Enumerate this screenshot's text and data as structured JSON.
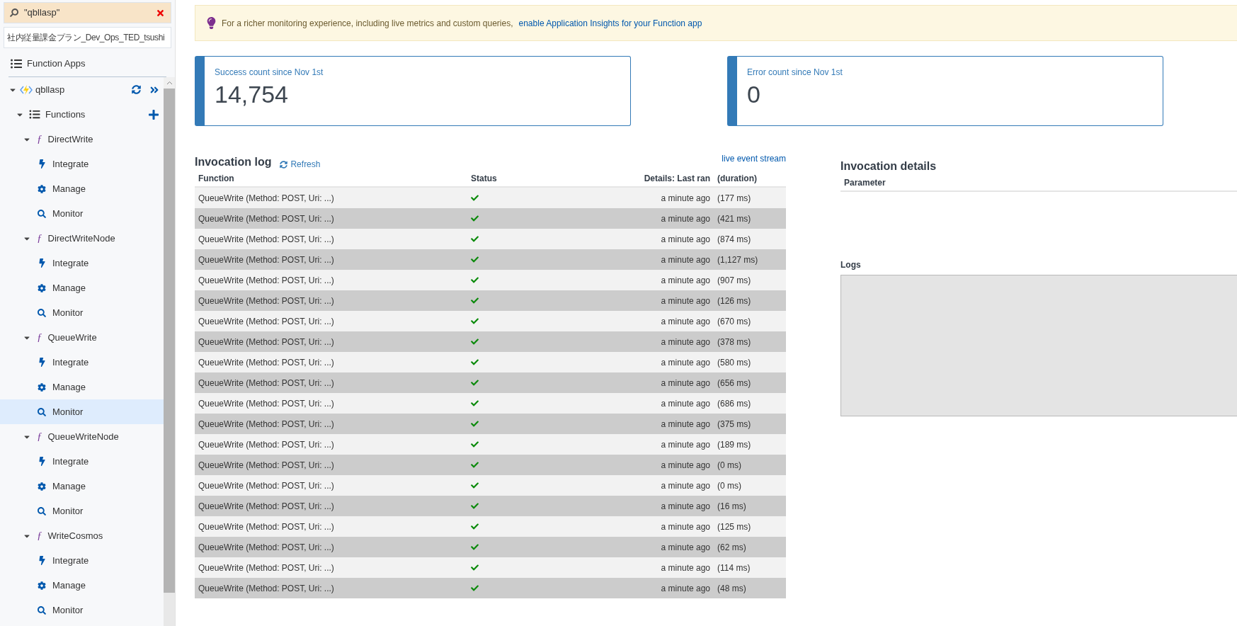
{
  "sidebar": {
    "search": {
      "value": "\"qbllasp\""
    },
    "subscription": {
      "value": "社内従量課金プラン_Dev_Ops_TED_tsushi"
    },
    "function_apps": {
      "label": "Function Apps"
    },
    "app": {
      "name": "qbllasp",
      "expanded": true,
      "functions": {
        "label": "Functions",
        "expanded": true,
        "children": [
          {
            "name": "DirectWrite",
            "glyph": "ƒ",
            "expanded": true,
            "children": [
              {
                "kind": "integrate",
                "label": "Integrate",
                "selected": false
              },
              {
                "kind": "manage",
                "label": "Manage",
                "selected": false
              },
              {
                "kind": "monitor",
                "label": "Monitor",
                "selected": false
              }
            ]
          },
          {
            "name": "DirectWriteNode",
            "glyph": "ƒ",
            "expanded": true,
            "children": [
              {
                "kind": "integrate",
                "label": "Integrate",
                "selected": false
              },
              {
                "kind": "manage",
                "label": "Manage",
                "selected": false
              },
              {
                "kind": "monitor",
                "label": "Monitor",
                "selected": false
              }
            ]
          },
          {
            "name": "QueueWrite",
            "glyph": "ƒ",
            "expanded": true,
            "children": [
              {
                "kind": "integrate",
                "label": "Integrate",
                "selected": false
              },
              {
                "kind": "manage",
                "label": "Manage",
                "selected": false
              },
              {
                "kind": "monitor",
                "label": "Monitor",
                "selected": true
              }
            ]
          },
          {
            "name": "QueueWriteNode",
            "glyph": "ƒ",
            "expanded": true,
            "children": [
              {
                "kind": "integrate",
                "label": "Integrate",
                "selected": false
              },
              {
                "kind": "manage",
                "label": "Manage",
                "selected": false
              },
              {
                "kind": "monitor",
                "label": "Monitor",
                "selected": false
              }
            ]
          },
          {
            "name": "WriteCosmos",
            "glyph": "ƒ",
            "expanded": true,
            "children": [
              {
                "kind": "integrate",
                "label": "Integrate",
                "selected": false
              },
              {
                "kind": "manage",
                "label": "Manage",
                "selected": false
              },
              {
                "kind": "monitor",
                "label": "Monitor",
                "selected": false
              }
            ]
          }
        ]
      }
    }
  },
  "banner": {
    "text": "For a richer monitoring experience, including live metrics and custom queries,",
    "link": "enable Application Insights for your Function app"
  },
  "cards": [
    {
      "label": "Success count since Nov 1st",
      "value": "14,754"
    },
    {
      "label": "Error count since Nov 1st",
      "value": "0"
    }
  ],
  "invocation_log": {
    "title": "Invocation log",
    "refresh": "Refresh",
    "live_stream": "live event stream",
    "columns": [
      "Function",
      "Status",
      "Details: Last ran",
      "(duration)"
    ],
    "rows": [
      {
        "function": "QueueWrite (Method: POST, Uri: ...)",
        "kind": "success",
        "last_ran": "a minute ago",
        "duration": "(177 ms)"
      },
      {
        "function": "QueueWrite (Method: POST, Uri: ...)",
        "kind": "success",
        "last_ran": "a minute ago",
        "duration": "(421 ms)"
      },
      {
        "function": "QueueWrite (Method: POST, Uri: ...)",
        "kind": "success",
        "last_ran": "a minute ago",
        "duration": "(874 ms)"
      },
      {
        "function": "QueueWrite (Method: POST, Uri: ...)",
        "kind": "success",
        "last_ran": "a minute ago",
        "duration": "(1,127 ms)"
      },
      {
        "function": "QueueWrite (Method: POST, Uri: ...)",
        "kind": "success",
        "last_ran": "a minute ago",
        "duration": "(907 ms)"
      },
      {
        "function": "QueueWrite (Method: POST, Uri: ...)",
        "kind": "success",
        "last_ran": "a minute ago",
        "duration": "(126 ms)"
      },
      {
        "function": "QueueWrite (Method: POST, Uri: ...)",
        "kind": "success",
        "last_ran": "a minute ago",
        "duration": "(670 ms)"
      },
      {
        "function": "QueueWrite (Method: POST, Uri: ...)",
        "kind": "success",
        "last_ran": "a minute ago",
        "duration": "(378 ms)"
      },
      {
        "function": "QueueWrite (Method: POST, Uri: ...)",
        "kind": "success",
        "last_ran": "a minute ago",
        "duration": "(580 ms)"
      },
      {
        "function": "QueueWrite (Method: POST, Uri: ...)",
        "kind": "success",
        "last_ran": "a minute ago",
        "duration": "(656 ms)"
      },
      {
        "function": "QueueWrite (Method: POST, Uri: ...)",
        "kind": "success",
        "last_ran": "a minute ago",
        "duration": "(686 ms)"
      },
      {
        "function": "QueueWrite (Method: POST, Uri: ...)",
        "kind": "success",
        "last_ran": "a minute ago",
        "duration": "(375 ms)"
      },
      {
        "function": "QueueWrite (Method: POST, Uri: ...)",
        "kind": "success",
        "last_ran": "a minute ago",
        "duration": "(189 ms)"
      },
      {
        "function": "QueueWrite (Method: POST, Uri: ...)",
        "kind": "success",
        "last_ran": "a minute ago",
        "duration": "(0 ms)"
      },
      {
        "function": "QueueWrite (Method: POST, Uri: ...)",
        "kind": "success",
        "last_ran": "a minute ago",
        "duration": "(0 ms)"
      },
      {
        "function": "QueueWrite (Method: POST, Uri: ...)",
        "kind": "success",
        "last_ran": "a minute ago",
        "duration": "(16 ms)"
      },
      {
        "function": "QueueWrite (Method: POST, Uri: ...)",
        "kind": "success",
        "last_ran": "a minute ago",
        "duration": "(125 ms)"
      },
      {
        "function": "QueueWrite (Method: POST, Uri: ...)",
        "kind": "success",
        "last_ran": "a minute ago",
        "duration": "(62 ms)"
      },
      {
        "function": "QueueWrite (Method: POST, Uri: ...)",
        "kind": "success",
        "last_ran": "a minute ago",
        "duration": "(114 ms)"
      },
      {
        "function": "QueueWrite (Method: POST, Uri: ...)",
        "kind": "success",
        "last_ran": "a minute ago",
        "duration": "(48 ms)"
      }
    ]
  },
  "details": {
    "title": "Invocation details",
    "columns": [
      "Parameter"
    ],
    "logs_label": "Logs"
  }
}
